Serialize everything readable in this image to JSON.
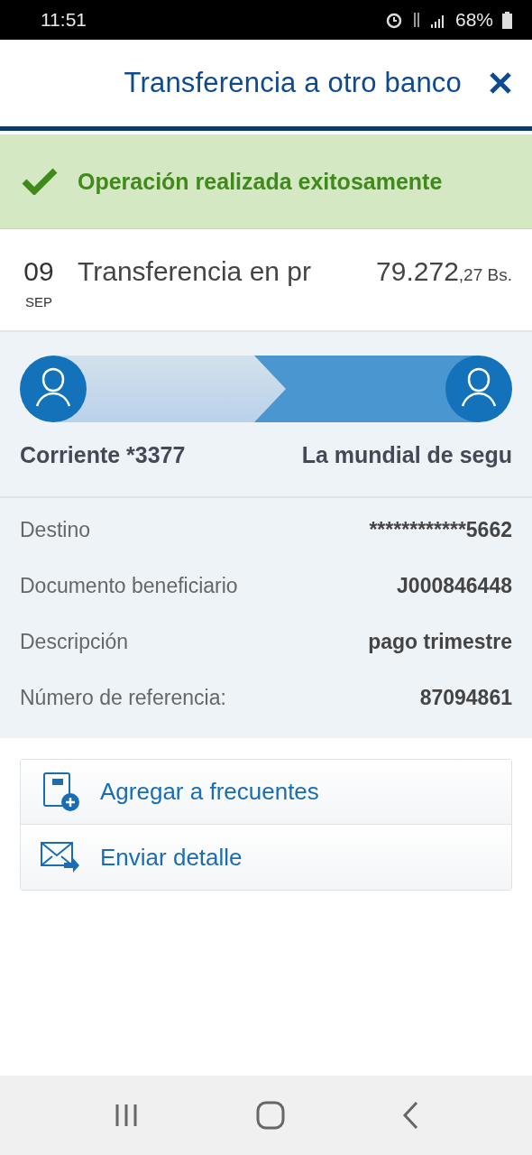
{
  "status_bar": {
    "time": "11:51",
    "battery": "68%"
  },
  "header": {
    "title": "Transferencia a otro banco"
  },
  "banner": {
    "message": "Operación realizada exitosamente"
  },
  "transaction": {
    "day": "09",
    "month": "SEP",
    "description": "Transferencia en pr",
    "amount": "79.272",
    "cents": ",27 Bs."
  },
  "transfer": {
    "from": "Corriente *3377",
    "to": "La mundial de segu"
  },
  "details": [
    {
      "label": "Destino",
      "value": "************5662"
    },
    {
      "label": "Documento beneficiario",
      "value": "J000846448"
    },
    {
      "label": "Descripción",
      "value": "pago trimestre"
    },
    {
      "label": "Número de referencia:",
      "value": "87094861"
    }
  ],
  "actions": [
    {
      "kind": "add",
      "label": "Agregar a frecuentes"
    },
    {
      "kind": "send",
      "label": "Enviar detalle"
    }
  ]
}
